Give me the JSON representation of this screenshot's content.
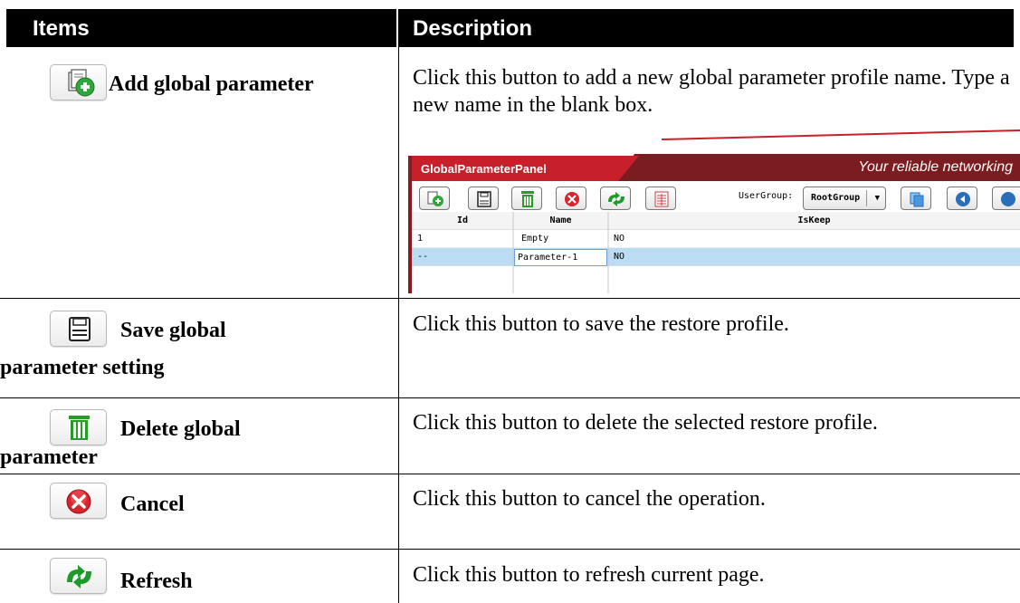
{
  "header": {
    "items": "Items",
    "description": "Description"
  },
  "rows": [
    {
      "label_line1": "Add global parameter",
      "label_line2": "",
      "icon": "add-parameter-icon",
      "description": "Click this button to add a new global parameter profile name. Type a new name in the blank box."
    },
    {
      "label_line1": "Save global",
      "label_line2": "parameter setting",
      "icon": "save-disk-icon",
      "description": "Click this button to save the restore profile."
    },
    {
      "label_line1": "Delete global",
      "label_line2": "parameter",
      "icon": "trash-can-icon",
      "description": "Click this button to delete the selected restore profile."
    },
    {
      "label_line1": "Cancel",
      "label_line2": "",
      "icon": "cancel-x-icon",
      "description": "Click this button to cancel the operation."
    },
    {
      "label_line1": "Refresh",
      "label_line2": "",
      "icon": "refresh-arrows-icon",
      "description": "Click this button to refresh current page."
    }
  ],
  "panel": {
    "title": "GlobalParameterPanel",
    "tagline": "Your reliable networking",
    "usergroup_label": "UserGroup:",
    "usergroup_value": "RootGroup",
    "colors": {
      "title_bar": "#c8202a",
      "banner": "#7a1c20",
      "selected_row": "#bcdcf4",
      "grid_line": "#c8c8c8"
    },
    "columns": [
      "Id",
      "Name",
      "IsKeep"
    ],
    "grid_rows": [
      {
        "id": "1",
        "name": "Empty",
        "iskeep": "NO"
      },
      {
        "id": "--",
        "name": "Parameter-1",
        "iskeep": "NO"
      }
    ]
  }
}
